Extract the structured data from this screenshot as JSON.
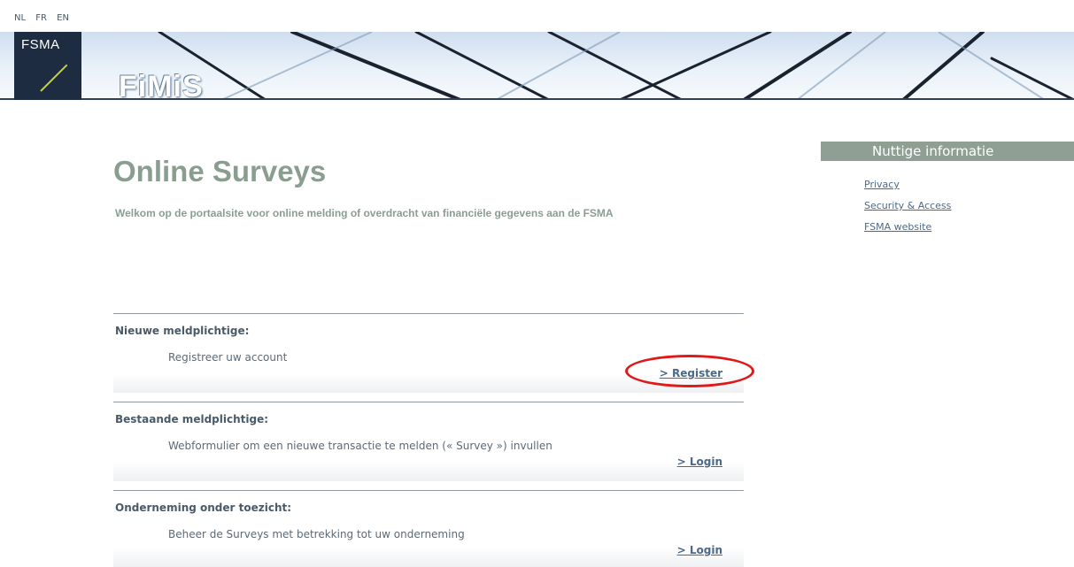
{
  "lang": [
    "NL",
    "FR",
    "EN"
  ],
  "header": {
    "org": "FSMA",
    "app": "FiMiS"
  },
  "main": {
    "title": "Online Surveys",
    "intro": "Welkom op de portaalsite voor online melding of overdracht van financiële gegevens aan de FSMA"
  },
  "sections": [
    {
      "heading": "Nieuwe meldplichtige:",
      "body": "Registreer uw account",
      "link": "> Register"
    },
    {
      "heading": "Bestaande meldplichtige:",
      "body": "Webformulier om een nieuwe transactie te melden (« Survey ») invullen",
      "link": "> Login"
    },
    {
      "heading": "Onderneming onder toezicht:",
      "body": "Beheer de Surveys met betrekking tot uw onderneming",
      "link": "> Login"
    }
  ],
  "sidebar": {
    "heading": "Nuttige informatie",
    "links": [
      "Privacy",
      "Security & Access",
      "FSMA website"
    ]
  },
  "colors": {
    "accent_green": "#8a9e90",
    "link_blue": "#4b6a8a",
    "highlight": "#e01818",
    "logo_bg": "#1d2c40"
  }
}
